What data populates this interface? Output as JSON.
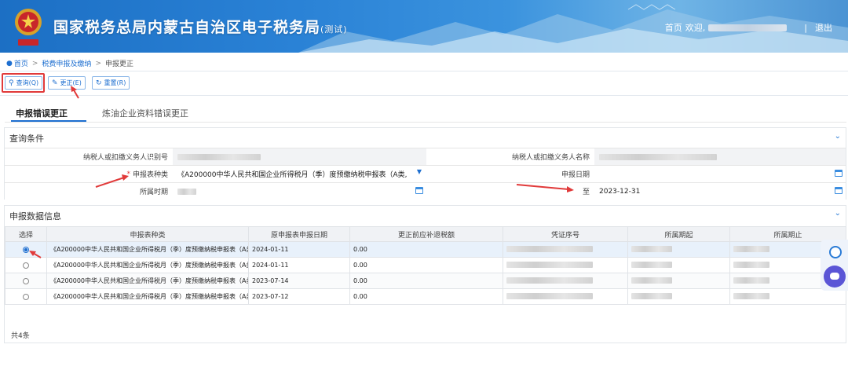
{
  "banner": {
    "title": "国家税务总局内蒙古自治区电子税务局",
    "title_suffix": "(测试)",
    "home_link": "首页",
    "welcome": "欢迎,",
    "separator": "|",
    "logout": "退出"
  },
  "breadcrumb": {
    "home": "首页",
    "level1": "税费申报及缴纳",
    "current": "申报更正",
    "sep": ">"
  },
  "toolbar": {
    "query_label": "查询(Q)",
    "correct_label": "更正(E)",
    "reset_label": "重置(R)"
  },
  "tabs": [
    {
      "label": "申报错误更正",
      "active": true
    },
    {
      "label": "炼油企业资料错误更正",
      "active": false
    }
  ],
  "query_panel": {
    "title": "查询条件",
    "taxpayer_id_label": "纳税人或扣缴义务人识别号",
    "taxpayer_name_label": "纳税人或扣缴义务人名称",
    "form_type_label": "申报表种类",
    "form_type_required": "*",
    "form_type_value": "《A200000中华人民共和国企业所得税月（季）度预缴纳税申报表（A类,",
    "report_date_label": "申报日期",
    "period_label": "所属时期",
    "period_to_label": "至",
    "period_to_value": "2023-12-31"
  },
  "data_panel": {
    "title": "申报数据信息",
    "columns": [
      "选择",
      "申报表种类",
      "原申报表申报日期",
      "更正前应补退税额",
      "凭证序号",
      "所属期起",
      "所属期止"
    ],
    "rows": [
      {
        "selected": true,
        "form": "《A200000中华人民共和国企业所得税月（季）度预缴纳税申报表（A类...",
        "date": "2024-01-11",
        "amount": "0.00"
      },
      {
        "selected": false,
        "form": "《A200000中华人民共和国企业所得税月（季）度预缴纳税申报表（A类...",
        "date": "2024-01-11",
        "amount": "0.00"
      },
      {
        "selected": false,
        "form": "《A200000中华人民共和国企业所得税月（季）度预缴纳税申报表（A类...",
        "date": "2023-07-14",
        "amount": "0.00"
      },
      {
        "selected": false,
        "form": "《A200000中华人民共和国企业所得税月（季）度预缴纳税申报表（A类...",
        "date": "2023-07-12",
        "amount": "0.00"
      }
    ],
    "total": "共4条"
  },
  "icons": {
    "query": "search-icon",
    "correct": "edit-icon",
    "reset": "refresh-icon",
    "calendar": "calendar-icon",
    "collapse": "chevron-down-icon"
  },
  "colors": {
    "brand_blue": "#1e6fd0",
    "highlight_red": "#e13a3a",
    "selected_row": "#e8f1fb"
  }
}
